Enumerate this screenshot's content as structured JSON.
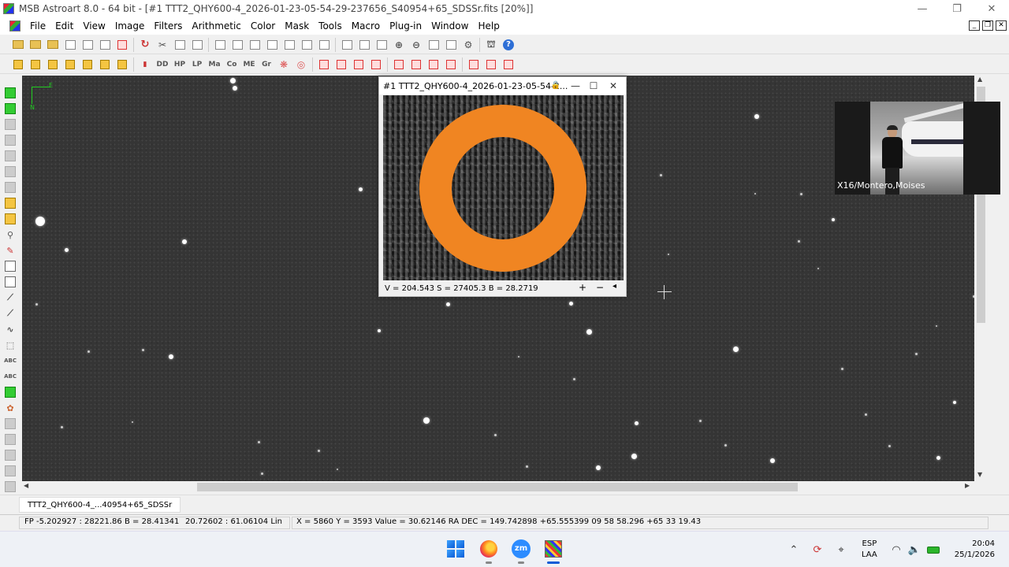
{
  "window": {
    "title": "MSB Astroart 8.0 - 64 bit - [#1 TTT2_QHY600-4_2026-01-23-05-54-29-237656_S40954+65_SDSSr.fits  [20%]]"
  },
  "menu": {
    "items": [
      "File",
      "Edit",
      "View",
      "Image",
      "Filters",
      "Arithmetic",
      "Color",
      "Mask",
      "Tools",
      "Macro",
      "Plug-in",
      "Window",
      "Help"
    ]
  },
  "toolbar2": {
    "labels": [
      "DD",
      "HP",
      "LP",
      "Ma",
      "Co",
      "ME",
      "Gr"
    ]
  },
  "lefttools": {
    "abc1": "ABC",
    "abc2": "ABC"
  },
  "compass": {
    "north": "N",
    "east": "E"
  },
  "zoom_window": {
    "title": "#1 TTT2_QHY600-4_2026-01-23-05-54-2...",
    "status": "V = 204.543   S = 27405.3  B = 28.2719",
    "plus": "+",
    "minus": "−",
    "collapse": "◂",
    "lock_icon": "🔒",
    "min": "—",
    "max": "☐",
    "close": "✕"
  },
  "video": {
    "name": "X16/Montero,Moises"
  },
  "doc_tab": {
    "label": "TTT2_QHY600-4_...40954+65_SDSSr"
  },
  "status": {
    "fp": "FP -5.202927 : 28221.86",
    "b": "B = 28.41341",
    "range": "20.72602 : 61.06104 Lin",
    "coords": "X = 5860  Y = 3593  Value = 30.62146    RA DEC = 149.742898 +65.555399    09 58 58.296 +65 33 19.43"
  },
  "taskbar": {
    "zoom_label": "zm",
    "lang_top": "ESP",
    "lang_bottom": "LAA",
    "time": "20:04",
    "date": "25/1/2026"
  },
  "colors": {
    "ring": "#f08522",
    "sky": "#353535",
    "compass": "#22cc22"
  }
}
